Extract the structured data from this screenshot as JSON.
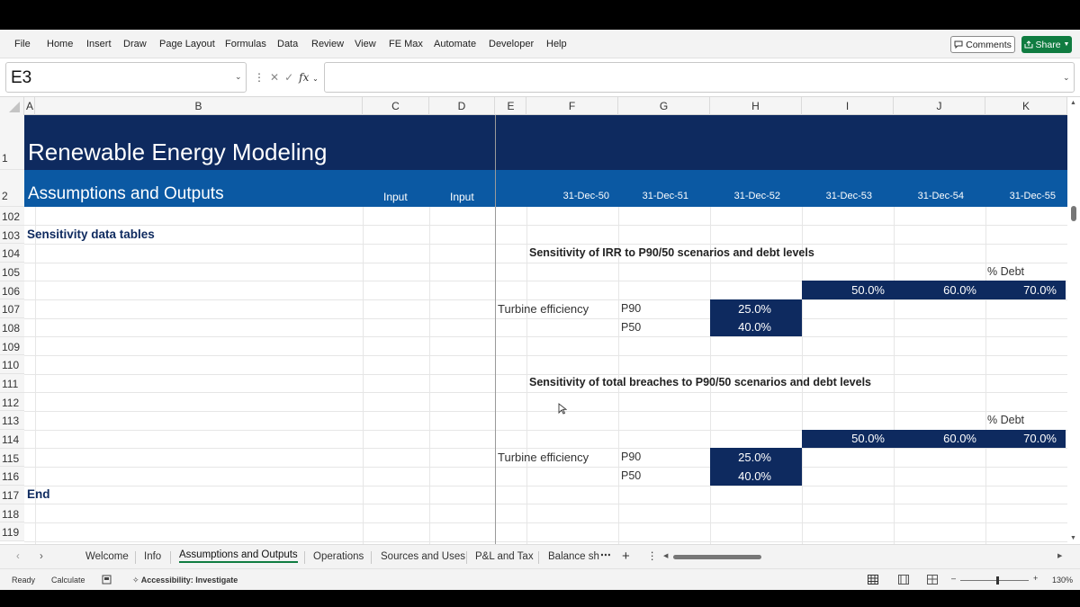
{
  "ribbon": {
    "menus": [
      "File",
      "Home",
      "Insert",
      "Draw",
      "Page Layout",
      "Formulas",
      "Data",
      "Review",
      "View",
      "FE Max",
      "Automate",
      "Developer",
      "Help"
    ],
    "comments_label": "Comments",
    "share_label": "Share"
  },
  "formula_bar": {
    "name_box": "E3",
    "fx_label": "fx",
    "formula": ""
  },
  "columns": [
    "A",
    "B",
    "C",
    "D",
    "E",
    "F",
    "G",
    "H",
    "I",
    "J",
    "K"
  ],
  "rows": {
    "r1": "1",
    "r2": "2",
    "list": [
      "102",
      "103",
      "104",
      "105",
      "106",
      "107",
      "108",
      "109",
      "110",
      "111",
      "112",
      "113",
      "114",
      "115",
      "116",
      "117",
      "118",
      "119"
    ]
  },
  "sheet": {
    "title": "Renewable Energy Modeling",
    "subtitle": "Assumptions and Outputs",
    "input_c": "Input",
    "input_d": "Input",
    "dates": [
      "31-Dec-50",
      "31-Dec-51",
      "31-Dec-52",
      "31-Dec-53",
      "31-Dec-54",
      "31-Dec-55"
    ],
    "section_label": "Sensitivity data tables",
    "end_label": "End",
    "table1": {
      "title": "Sensitivity of IRR to P90/50 scenarios and debt levels",
      "debt_label": "% Debt",
      "debt_levels": [
        "50.0%",
        "60.0%",
        "70.0%"
      ],
      "row_label": "Turbine efficiency",
      "scenarios": [
        "P90",
        "P50"
      ],
      "values": [
        "25.0%",
        "40.0%"
      ]
    },
    "table2": {
      "title": "Sensitivity of total breaches to P90/50 scenarios and debt levels",
      "debt_label": "% Debt",
      "debt_levels": [
        "50.0%",
        "60.0%",
        "70.0%"
      ],
      "row_label": "Turbine efficiency",
      "scenarios": [
        "P90",
        "P50"
      ],
      "values": [
        "25.0%",
        "40.0%"
      ]
    }
  },
  "tabs": {
    "list": [
      "Welcome",
      "Info",
      "Assumptions and Outputs",
      "Operations",
      "Sources and Uses",
      "P&L and Tax",
      "Balance sh"
    ],
    "active": "Assumptions and Outputs"
  },
  "status": {
    "ready": "Ready",
    "calculate": "Calculate",
    "accessibility": "Accessibility: Investigate",
    "zoom": "130%"
  }
}
